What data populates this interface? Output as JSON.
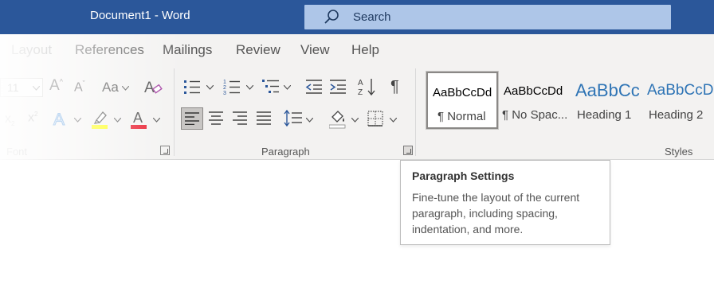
{
  "titlebar": {
    "document_title": "Document1  -  Word",
    "search_label": "Search"
  },
  "tabs": [
    {
      "label": "Layout"
    },
    {
      "label": "References"
    },
    {
      "label": "Mailings"
    },
    {
      "label": "Review"
    },
    {
      "label": "View"
    },
    {
      "label": "Help"
    }
  ],
  "font_group": {
    "label": "Font",
    "font_size": "11",
    "grow_font": "A",
    "shrink_font": "A",
    "change_case": "Aa",
    "subscript": "x",
    "superscript": "x",
    "font_color_letter": "A",
    "highlight_color": "#ffff00",
    "font_color": "#e81123"
  },
  "paragraph_group": {
    "label": "Paragraph"
  },
  "styles_group": {
    "label": "Styles",
    "tiles": [
      {
        "preview": "AaBbCcDd",
        "caption": "¶ Normal"
      },
      {
        "preview": "AaBbCcDd",
        "caption": "¶ No Spac..."
      },
      {
        "preview": "AaBbCc",
        "caption": "Heading 1"
      },
      {
        "preview": "AaBbCcD",
        "caption": "Heading 2"
      }
    ]
  },
  "tooltip": {
    "title": "Paragraph Settings",
    "body": "Fine-tune the layout of the current paragraph, including spacing, indentation, and more."
  },
  "colors": {
    "titlebar": "#2b579a",
    "ribbon": "#f3f2f1",
    "heading_blue": "#2e74b5"
  }
}
